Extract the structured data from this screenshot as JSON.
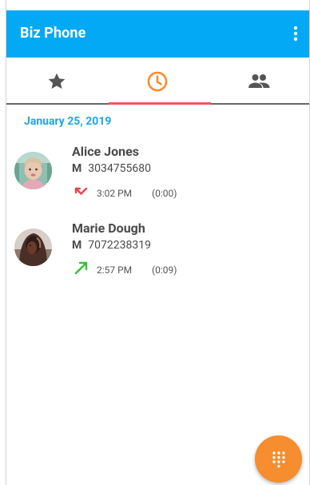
{
  "app": {
    "title": "Biz Phone"
  },
  "colors": {
    "appbar": "#03a9f4",
    "active_tab": "#f68d2e",
    "tab_indicator": "#f2575b",
    "date_header": "#1aa6e5",
    "missed_call": "#e8434a",
    "outgoing_call": "#35c234",
    "fab": "#f68d2e"
  },
  "tabs": [
    {
      "icon": "star-icon",
      "active": false
    },
    {
      "icon": "clock-icon",
      "active": true
    },
    {
      "icon": "people-icon",
      "active": false
    }
  ],
  "history": {
    "date": "January 25, 2019",
    "calls": [
      {
        "name": "Alice Jones",
        "phone_type": "M",
        "number": "3034755680",
        "direction": "missed",
        "direction_icon": "missed-call-icon",
        "time": "3:02 PM",
        "duration": "(0:00)"
      },
      {
        "name": "Marie Dough",
        "phone_type": "M",
        "number": "7072238319",
        "direction": "outgoing",
        "direction_icon": "outgoing-call-icon",
        "time": "2:57 PM",
        "duration": "(0:09)"
      }
    ]
  },
  "fab": {
    "icon": "dialpad-icon"
  }
}
